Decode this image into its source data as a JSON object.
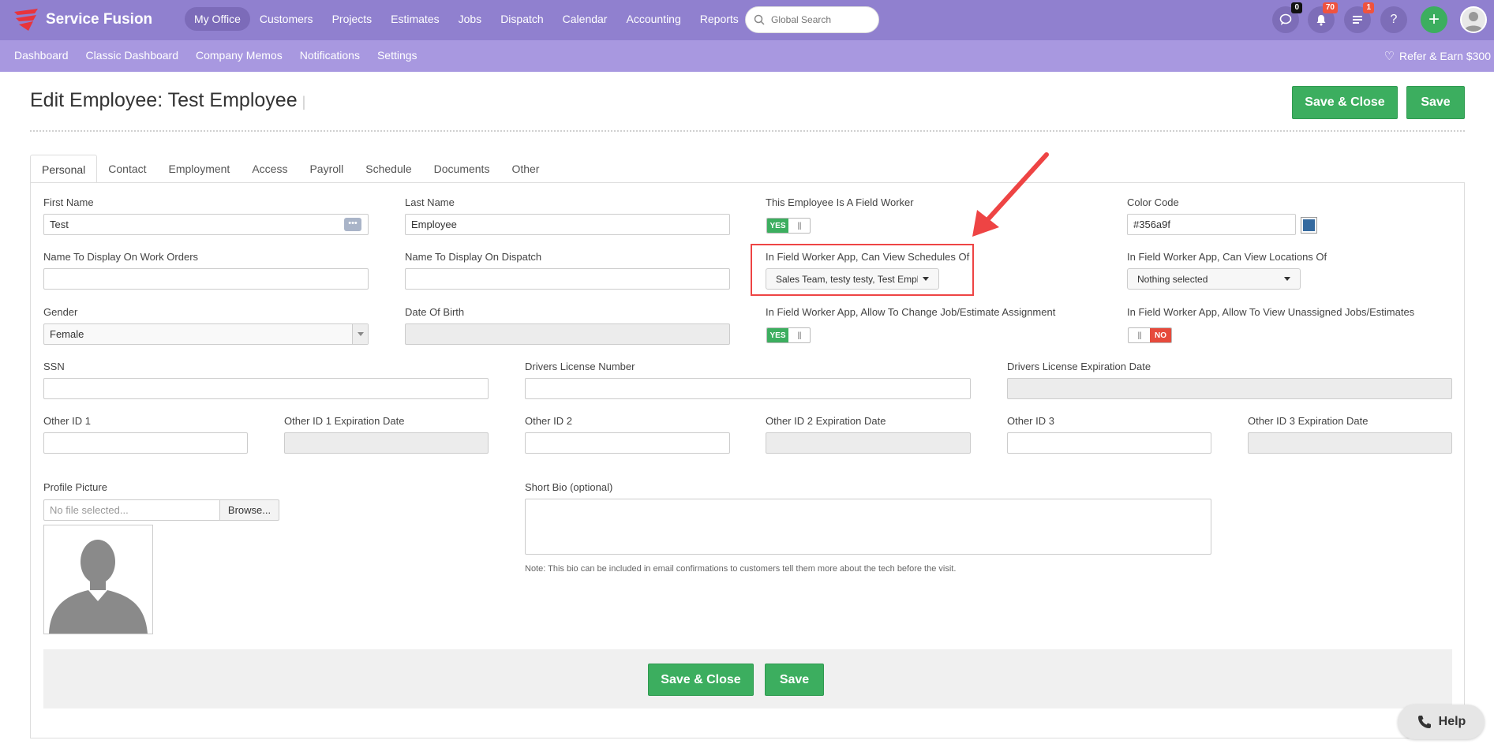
{
  "app": {
    "name": "Service Fusion"
  },
  "nav": {
    "items": [
      "My Office",
      "Customers",
      "Projects",
      "Estimates",
      "Jobs",
      "Dispatch",
      "Calendar",
      "Accounting",
      "Reports"
    ],
    "active": "My Office"
  },
  "search": {
    "placeholder": "Global Search"
  },
  "header_icons": {
    "chat_badge": "0",
    "notifications_badge": "70",
    "tasks_badge": "1",
    "help": "?",
    "add": "+"
  },
  "subnav": {
    "items": [
      "Dashboard",
      "Classic Dashboard",
      "Company Memos",
      "Notifications",
      "Settings"
    ],
    "refer": "Refer & Earn $300"
  },
  "page": {
    "title": "Edit Employee: Test Employee",
    "save_close": "Save & Close",
    "save": "Save"
  },
  "tabs": [
    "Personal",
    "Contact",
    "Employment",
    "Access",
    "Payroll",
    "Schedule",
    "Documents",
    "Other"
  ],
  "form": {
    "first_name": {
      "label": "First Name",
      "value": "Test"
    },
    "last_name": {
      "label": "Last Name",
      "value": "Employee"
    },
    "field_worker": {
      "label": "This Employee Is A Field Worker",
      "value": "YES"
    },
    "color_code": {
      "label": "Color Code",
      "value": "#356a9f",
      "swatch": "#356a9f"
    },
    "wo_name": {
      "label": "Name To Display On Work Orders",
      "value": ""
    },
    "dispatch_name": {
      "label": "Name To Display On Dispatch",
      "value": ""
    },
    "view_schedules": {
      "label": "In Field Worker App, Can View Schedules Of",
      "value": "Sales Team, testy testy, Test Empl"
    },
    "view_locations": {
      "label": "In Field Worker App, Can View Locations Of",
      "value": "Nothing selected"
    },
    "gender": {
      "label": "Gender",
      "value": "Female"
    },
    "dob": {
      "label": "Date Of Birth",
      "value": ""
    },
    "change_assignment": {
      "label": "In Field Worker App, Allow To Change Job/Estimate Assignment",
      "value": "YES"
    },
    "view_unassigned": {
      "label": "In Field Worker App, Allow To View Unassigned Jobs/Estimates",
      "value": "NO"
    },
    "ssn": {
      "label": "SSN",
      "value": ""
    },
    "dl_number": {
      "label": "Drivers License Number",
      "value": ""
    },
    "dl_expiration": {
      "label": "Drivers License Expiration Date",
      "value": ""
    },
    "other_id1": {
      "label": "Other ID 1",
      "value": ""
    },
    "other_id1_exp": {
      "label": "Other ID 1 Expiration Date",
      "value": ""
    },
    "other_id2": {
      "label": "Other ID 2",
      "value": ""
    },
    "other_id2_exp": {
      "label": "Other ID 2 Expiration Date",
      "value": ""
    },
    "other_id3": {
      "label": "Other ID 3",
      "value": ""
    },
    "other_id3_exp": {
      "label": "Other ID 3 Expiration Date",
      "value": ""
    },
    "profile_picture": {
      "label": "Profile Picture",
      "placeholder": "No file selected...",
      "browse": "Browse..."
    },
    "short_bio": {
      "label": "Short Bio (optional)",
      "note": "Note: This bio can be included in email confirmations to customers tell them more about the tech before the visit."
    }
  },
  "help": {
    "label": "Help"
  },
  "colors": {
    "topbar": "#9080cf",
    "subbar": "#a898e0",
    "green": "#3cae5f",
    "red": "#e64a3c",
    "annotation": "#e44"
  }
}
